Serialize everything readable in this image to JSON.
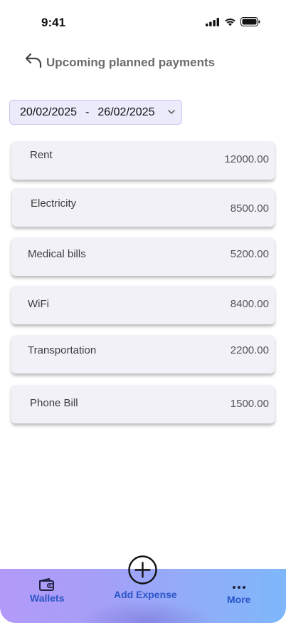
{
  "status_bar": {
    "time": "9:41"
  },
  "header": {
    "title": "Upcoming planned payments"
  },
  "date_range": {
    "start": "20/02/2025",
    "separator": "-",
    "end": "26/02/2025"
  },
  "payments": [
    {
      "name": "Rent",
      "amount": "12000.00"
    },
    {
      "name": "Electricity",
      "amount": "8500.00"
    },
    {
      "name": "Medical bills",
      "amount": "5200.00"
    },
    {
      "name": "WiFi",
      "amount": "8400.00"
    },
    {
      "name": "Transportation",
      "amount": "2200.00"
    },
    {
      "name": "Phone Bill",
      "amount": "1500.00"
    }
  ],
  "bottom_nav": {
    "wallets_label": "Wallets",
    "add_label": "Add Expense",
    "more_label": "More"
  },
  "icons": {
    "back": "back-arrow-icon",
    "dropdown": "chevron-down-icon",
    "wallet": "wallet-icon",
    "add": "plus-circle-icon",
    "more": "more-dots-icon"
  }
}
